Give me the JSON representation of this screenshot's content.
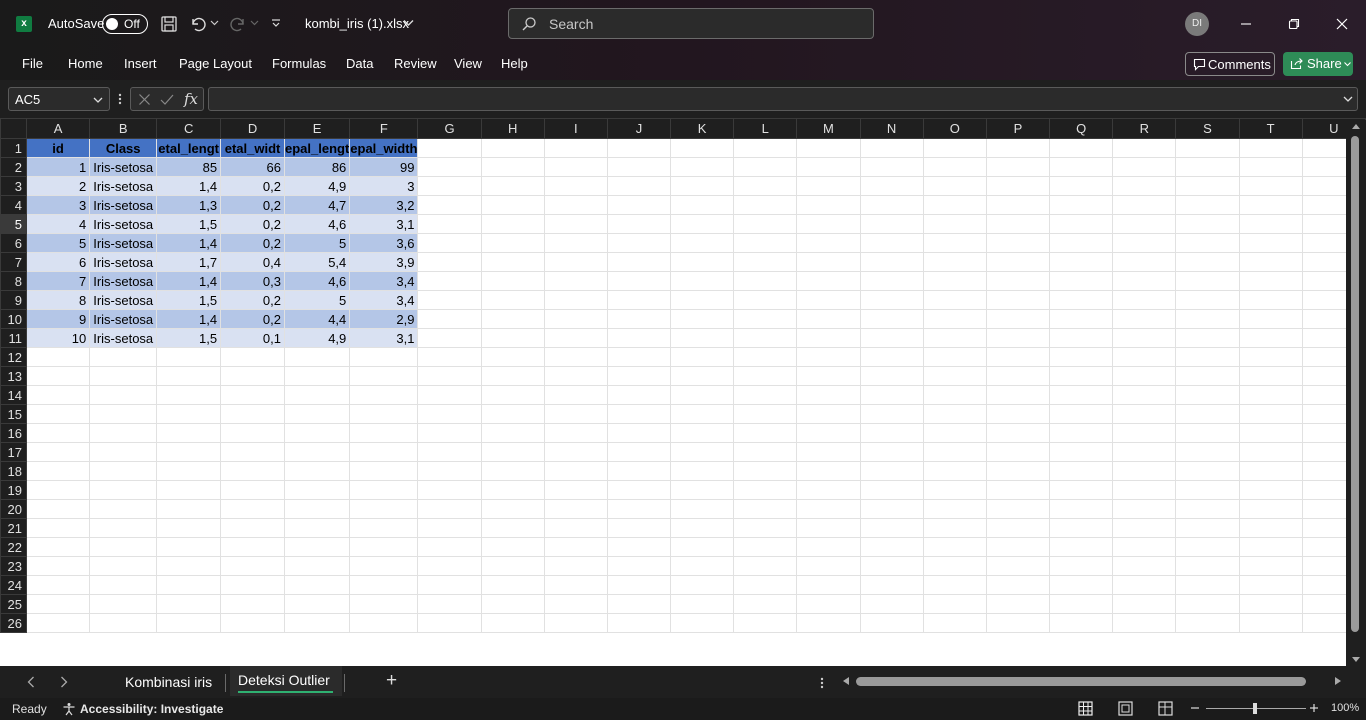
{
  "app": {
    "autosave_label": "AutoSave",
    "autosave_state": "Off",
    "filename": "kombi_iris (1).xlsx",
    "search_placeholder": "Search",
    "user_initials": "DI",
    "brand_color": "#107c41"
  },
  "ribbon": {
    "tabs": [
      "File",
      "Home",
      "Insert",
      "Page Layout",
      "Formulas",
      "Data",
      "Review",
      "View",
      "Help"
    ],
    "comments_label": "Comments",
    "share_label": "Share"
  },
  "formula_bar": {
    "name_box": "AC5",
    "fx_label": "fx",
    "content": ""
  },
  "sheet": {
    "columns": [
      "A",
      "B",
      "C",
      "D",
      "E",
      "F",
      "G",
      "H",
      "I",
      "J",
      "K",
      "L",
      "M",
      "N",
      "O",
      "P",
      "Q",
      "R",
      "S",
      "T",
      "U"
    ],
    "rows": [
      "1",
      "2",
      "3",
      "4",
      "5",
      "6",
      "7",
      "8",
      "9",
      "10",
      "11",
      "12",
      "13",
      "14",
      "15",
      "16",
      "17",
      "18",
      "19",
      "20",
      "21",
      "22",
      "23",
      "24",
      "25",
      "26"
    ],
    "headers": [
      "id",
      "Class",
      "etal_lengt",
      "etal_widt",
      "epal_lengt",
      "epal_width"
    ],
    "data": [
      [
        "1",
        "Iris-setosa",
        "85",
        "66",
        "86",
        "99"
      ],
      [
        "2",
        "Iris-setosa",
        "1,4",
        "0,2",
        "4,9",
        "3"
      ],
      [
        "3",
        "Iris-setosa",
        "1,3",
        "0,2",
        "4,7",
        "3,2"
      ],
      [
        "4",
        "Iris-setosa",
        "1,5",
        "0,2",
        "4,6",
        "3,1"
      ],
      [
        "5",
        "Iris-setosa",
        "1,4",
        "0,2",
        "5",
        "3,6"
      ],
      [
        "6",
        "Iris-setosa",
        "1,7",
        "0,4",
        "5,4",
        "3,9"
      ],
      [
        "7",
        "Iris-setosa",
        "1,4",
        "0,3",
        "4,6",
        "3,4"
      ],
      [
        "8",
        "Iris-setosa",
        "1,5",
        "0,2",
        "5",
        "3,4"
      ],
      [
        "9",
        "Iris-setosa",
        "1,4",
        "0,2",
        "4,4",
        "2,9"
      ],
      [
        "10",
        "Iris-setosa",
        "1,5",
        "0,1",
        "4,9",
        "3,1"
      ]
    ],
    "selected_row": "5"
  },
  "sheet_tabs": {
    "tabs": [
      "Kombinasi iris",
      "Deteksi Outlier"
    ],
    "active": "Deteksi Outlier",
    "add_label": "+"
  },
  "status_bar": {
    "ready": "Ready",
    "accessibility": "Accessibility: Investigate",
    "zoom": "100%"
  }
}
